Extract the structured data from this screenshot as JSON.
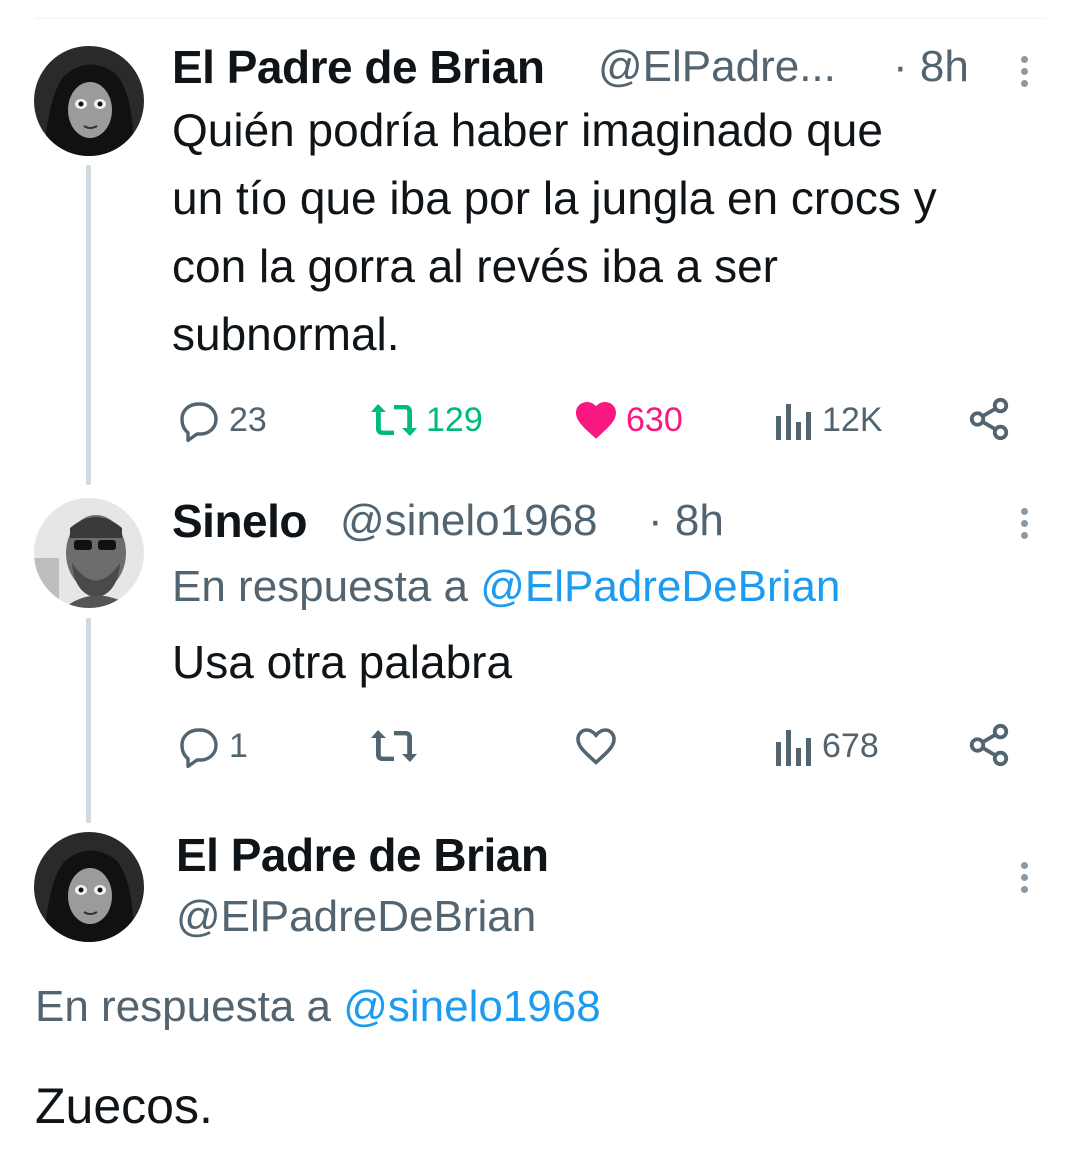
{
  "tweets": [
    {
      "name": "El Padre de Brian",
      "handle": "@ElPadre...",
      "time": "· 8h",
      "text": "Quién podría haber imaginado que\nun tío que iba por la jungla en crocs y\ncon la gorra al revés iba a ser\nsubnormal.",
      "replies": "23",
      "retweets": "129",
      "likes": "630",
      "views": "12K",
      "liked": true,
      "retweeted": true
    },
    {
      "name": "Sinelo",
      "handle": "@sinelo1968",
      "time": "· 8h",
      "reply_prefix": "En respuesta a",
      "reply_target": "@ElPadreDeBrian",
      "text": "Usa otra palabra",
      "replies": "1",
      "retweets": "",
      "likes": "",
      "views": "678"
    },
    {
      "name": "El Padre de Brian",
      "handle": "@ElPadreDeBrian",
      "reply_prefix": "En respuesta a",
      "reply_target": "@sinelo1968",
      "text": "Zuecos."
    }
  ],
  "icons": {
    "reply": "reply-icon",
    "retweet": "retweet-icon",
    "like": "heart-icon",
    "views": "views-icon",
    "share": "share-icon",
    "more": "more-options-icon"
  },
  "colors": {
    "link": "#1d9bf0",
    "retweet_active": "#00ba7c",
    "like_active": "#f91880",
    "secondary_text": "#536471",
    "thread_line": "#cfd9de"
  }
}
